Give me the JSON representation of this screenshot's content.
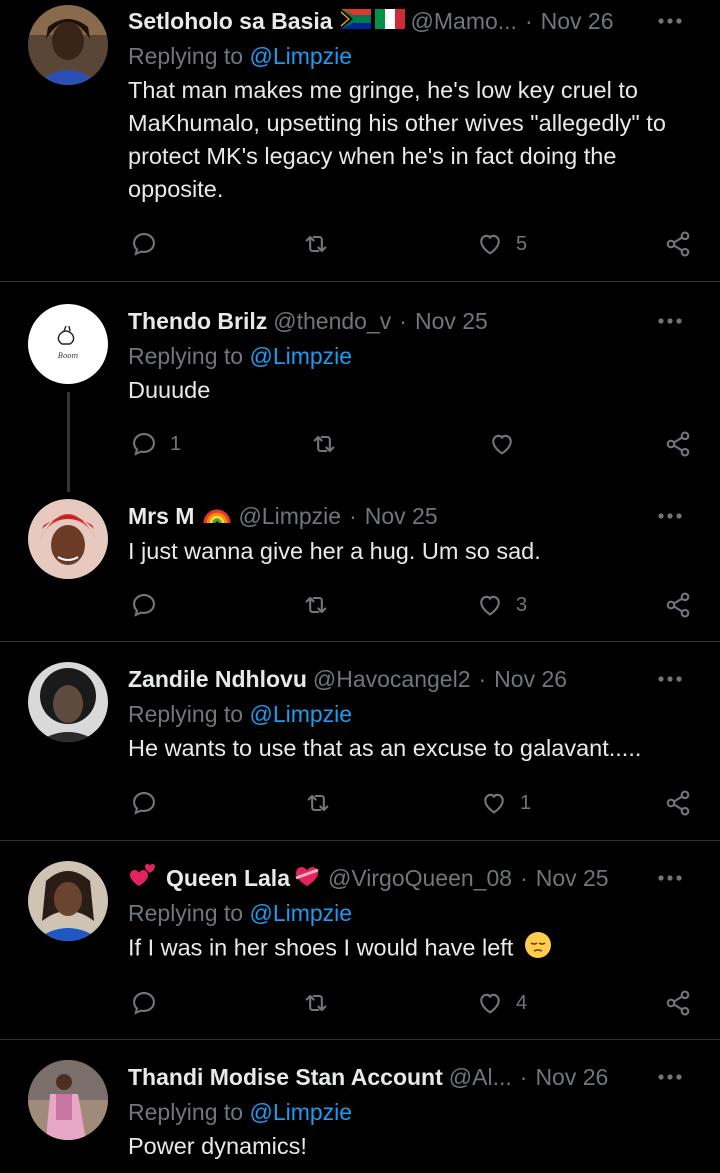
{
  "tweets": [
    {
      "name": "Setloholo sa Basia",
      "handle": "@Mamo...",
      "time": "Nov 26",
      "replying_prefix": "Replying to ",
      "replying_handle": "@Limpzie",
      "text": "That man makes me gringe, he's low key cruel to MaKhumalo, upsetting his other wives \"allegedly\" to protect MK's legacy when he's in fact doing the opposite.",
      "replies": "",
      "retweets": "",
      "likes": "5"
    },
    {
      "name": "Thendo Brilz",
      "handle": "@thendo_v",
      "time": "Nov 25",
      "replying_prefix": "Replying to ",
      "replying_handle": "@Limpzie",
      "text": "Duuude",
      "replies": "1",
      "retweets": "",
      "likes": ""
    },
    {
      "name": "Mrs M",
      "handle": "@Limpzie",
      "time": "Nov 25",
      "text": "I just wanna give her a hug. Um so sad.",
      "replies": "",
      "retweets": "",
      "likes": "3"
    },
    {
      "name": "Zandile Ndhlovu",
      "handle": "@Havocangel2",
      "time": "Nov 26",
      "replying_prefix": "Replying to ",
      "replying_handle": "@Limpzie",
      "text": "He wants to use that as an excuse to galavant.....",
      "replies": "",
      "retweets": "",
      "likes": "1"
    },
    {
      "name": "Queen Lala",
      "handle": "@VirgoQueen_08",
      "time": "Nov 25",
      "replying_prefix": "Replying to ",
      "replying_handle": "@Limpzie",
      "text": "If I was in her shoes I would have left",
      "replies": "",
      "retweets": "",
      "likes": "4"
    },
    {
      "name": "Thandi Modise Stan Account",
      "handle": "@Al...",
      "time": "Nov 26",
      "replying_prefix": "Replying to ",
      "replying_handle": "@Limpzie",
      "text": "Power dynamics!"
    }
  ],
  "dot": "·",
  "avatar2_logo_text": "Boom",
  "colors": {
    "background": "#000000",
    "text": "#e7e9ea",
    "muted": "#71767b",
    "link": "#1d9bf0",
    "divider": "#2f3336"
  },
  "icons": {
    "reply": "reply-icon",
    "retweet": "retweet-icon",
    "like": "heart-icon",
    "share": "share-icon",
    "more": "more-dots-icon"
  }
}
